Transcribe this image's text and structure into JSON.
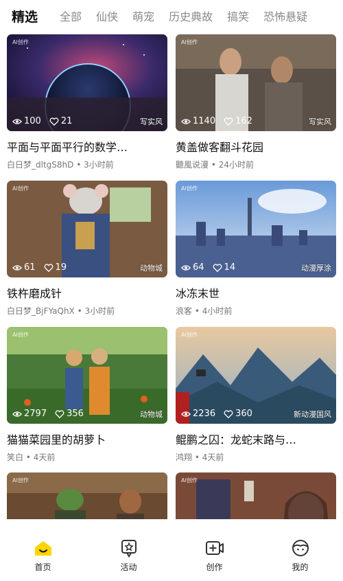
{
  "tabs": [
    "精选",
    "全部",
    "仙侠",
    "萌宠",
    "历史典故",
    "搞笑",
    "恐怖悬疑"
  ],
  "watermark": "AI创作",
  "cards": [
    {
      "views": "100",
      "likes": "21",
      "style": "写实风",
      "title": "平面与平面平行的数学…",
      "author": "白日梦_dltgS8hD",
      "time": "3小时前"
    },
    {
      "views": "1140",
      "likes": "162",
      "style": "写实风",
      "title": "黄盖做客翻斗花园",
      "author": "聽風说漫",
      "time": "24小时前"
    },
    {
      "views": "61",
      "likes": "19",
      "style": "动物城",
      "title": "铁杵磨成针",
      "author": "白日梦_BjFYaQhX",
      "time": "3小时前"
    },
    {
      "views": "64",
      "likes": "14",
      "style": "动漫厚涂",
      "title": "冰冻末世",
      "author": "浪客",
      "time": "4小时前"
    },
    {
      "views": "2797",
      "likes": "356",
      "style": "动物城",
      "title": "猫猫菜园里的胡萝卜",
      "author": "笑白",
      "time": "4天前"
    },
    {
      "views": "2236",
      "likes": "360",
      "style": "新动漫国风",
      "title": "鲲鹏之囚：龙蛇末路与…",
      "author": "鸿翔",
      "time": "4天前"
    },
    {
      "views": "",
      "likes": "",
      "style": "",
      "title": "",
      "author": "",
      "time": ""
    },
    {
      "views": "",
      "likes": "",
      "style": "",
      "title": "",
      "author": "",
      "time": ""
    }
  ],
  "nav": [
    {
      "label": "首页",
      "icon": "home-icon",
      "active": true
    },
    {
      "label": "活动",
      "icon": "activity-star-icon",
      "active": false
    },
    {
      "label": "创作",
      "icon": "create-video-icon",
      "active": false
    },
    {
      "label": "我的",
      "icon": "profile-face-icon",
      "active": false
    }
  ],
  "colors": {
    "accent": "#FFD400",
    "text": "#111111",
    "muted": "#8A8A8A"
  }
}
